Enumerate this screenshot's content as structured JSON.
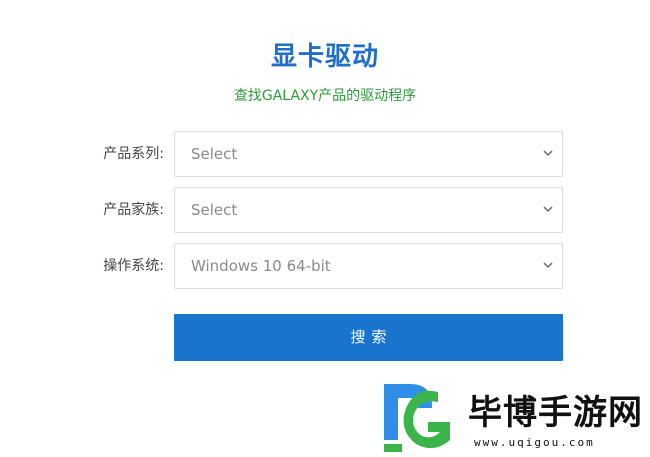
{
  "header": {
    "title": "显卡驱动",
    "subtitle": "查找GALAXY产品的驱动程序"
  },
  "form": {
    "fields": [
      {
        "label": "产品系列:",
        "value": "Select"
      },
      {
        "label": "产品家族:",
        "value": "Select"
      },
      {
        "label": "操作系统:",
        "value": "Windows 10 64-bit"
      }
    ],
    "search_label": "搜索"
  },
  "watermark": {
    "brand": "毕博手游网",
    "url": "www.uqigou.com"
  },
  "colors": {
    "title": "#1f6fc9",
    "subtitle": "#2e9a3a",
    "button": "#1874cd"
  }
}
